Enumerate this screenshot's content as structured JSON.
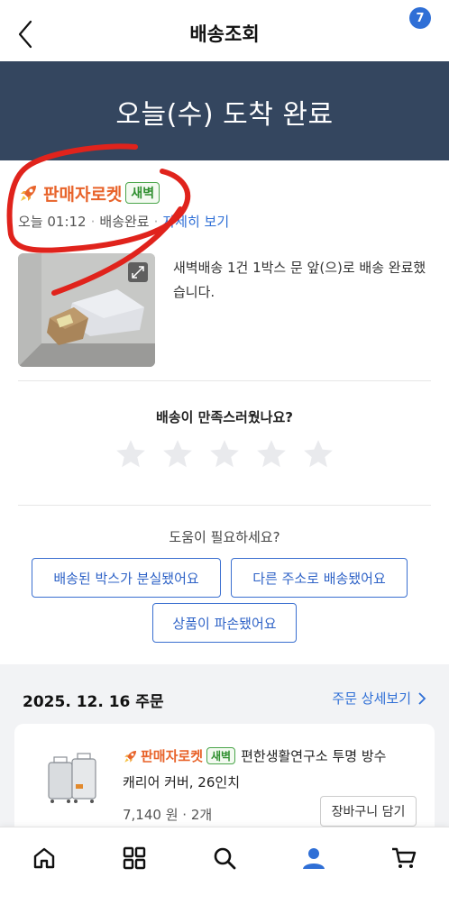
{
  "header": {
    "title": "배송조회"
  },
  "banner": {
    "status_text": "오늘(수) 도착 완료"
  },
  "delivery": {
    "seller_name": "판매자로켓",
    "badge": "새벽",
    "time": "오늘 01:12",
    "status": "배송완료",
    "detail_link": "자세히 보기",
    "message": "새벽배송 1건 1박스 문 앞(으)로 배송 완료했습니다."
  },
  "rating": {
    "question": "배송이 만족스러웠나요?",
    "max_stars": 5,
    "star_color": "#e9eaed"
  },
  "help": {
    "question": "도움이 필요하세요?",
    "buttons": [
      "배송된 박스가 분실됐어요",
      "다른 주소로 배송됐어요",
      "상품이 파손됐어요"
    ]
  },
  "order": {
    "date_label": "2025. 12. 16 주문",
    "detail_link": "주문 상세보기",
    "item": {
      "seller_name": "판매자로켓",
      "badge": "새벽",
      "name_line1": "편한생활연구소 투명 방수",
      "name_line2": "캐리어 커버, 26인치",
      "price": "7,140 원 · 2개",
      "cart_button": "장바구니 담기"
    }
  },
  "nav": {
    "items": [
      "home-icon",
      "category-icon",
      "search-icon",
      "my-account-icon",
      "cart-icon"
    ],
    "cart_count": "7",
    "accent": "#2f6fd6"
  },
  "colors": {
    "banner": "#34465f",
    "seller_orange": "#e8632a",
    "badge_green": "#2f8f2f",
    "link_blue": "#2f6fd6",
    "annotation_red": "#e0231c"
  }
}
